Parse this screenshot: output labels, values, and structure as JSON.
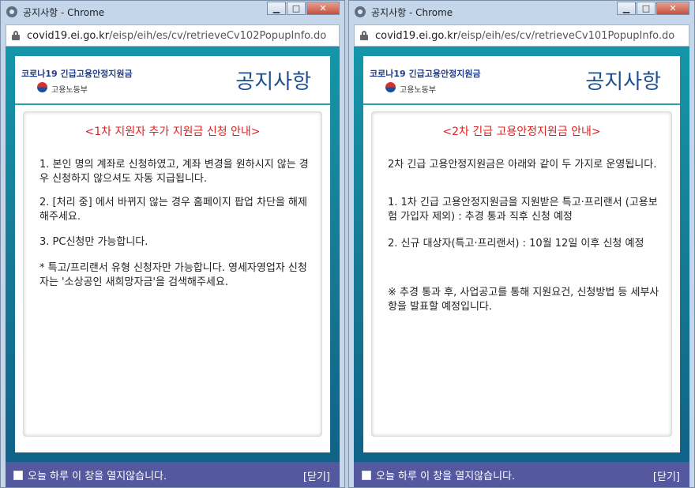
{
  "windows": [
    {
      "title": "공지사항 - Chrome",
      "url_host": "covid19.ei.go.kr",
      "url_path": "/eisp/eih/es/cv/retrieveCv102PopupInfo.do",
      "org_name": "코로나19 긴급고용안정지원금",
      "ministry": "고용노동부",
      "notice_title": "공지사항",
      "panel_title": "<1차 지원자 추가 지원금 신청 안내>",
      "paragraphs": [
        "1. 본인 명의 계좌로 신청하였고, 계좌 변경을 원하시지 않는 경우 신청하지 않으셔도 자동 지급됩니다.",
        "2. [처리 중] 에서 바뀌지 않는 경우 홈페이지 팝업 차단을 해제해주세요.",
        "3. PC신청만 가능합니다.",
        "* 특고/프리랜서 유형 신청자만 가능합니다. 영세자영업자 신청자는 '소상공인 새희망자금'을 검색해주세요."
      ],
      "footer_label": "오늘 하루 이 창을 열지않습니다.",
      "close_label": "[닫기]"
    },
    {
      "title": "공지사항 - Chrome",
      "url_host": "covid19.ei.go.kr",
      "url_path": "/eisp/eih/es/cv/retrieveCv101PopupInfo.do",
      "org_name": "코로나19 긴급고용안정지원금",
      "ministry": "고용노동부",
      "notice_title": "공지사항",
      "panel_title": "<2차 긴급 고용안정지원금 안내>",
      "paragraphs": [
        "2차 긴급 고용안정지원금은 아래와 같이 두 가지로 운영됩니다.",
        "1. 1차 긴급 고용안정지원금을 지원받은 특고·프리랜서 (고용보험 가입자 제외) : 추경 통과 직후 신청 예정",
        "2. 신규 대상자(특고·프리랜서) : 10월 12일 이후 신청 예정",
        "※ 추경 통과 후, 사업공고를 통해 지원요건, 신청방법 등 세부사항을 발표할 예정입니다."
      ],
      "footer_label": "오늘 하루 이 창을 열지않습니다.",
      "close_label": "[닫기]"
    }
  ],
  "window_buttons": {
    "minimize": "▁",
    "maximize": "□",
    "close": "✕"
  },
  "icons": {
    "browser": "chrome-icon",
    "secure": "lock-icon",
    "logo": "taeguk-icon",
    "checkbox": "checkbox"
  },
  "colors": {
    "background_teal": "#1496a8",
    "footer": "#53589f",
    "panel_title": "#e0201d",
    "notice_title": "#1d4f8f",
    "org_name": "#1f3d8a"
  }
}
